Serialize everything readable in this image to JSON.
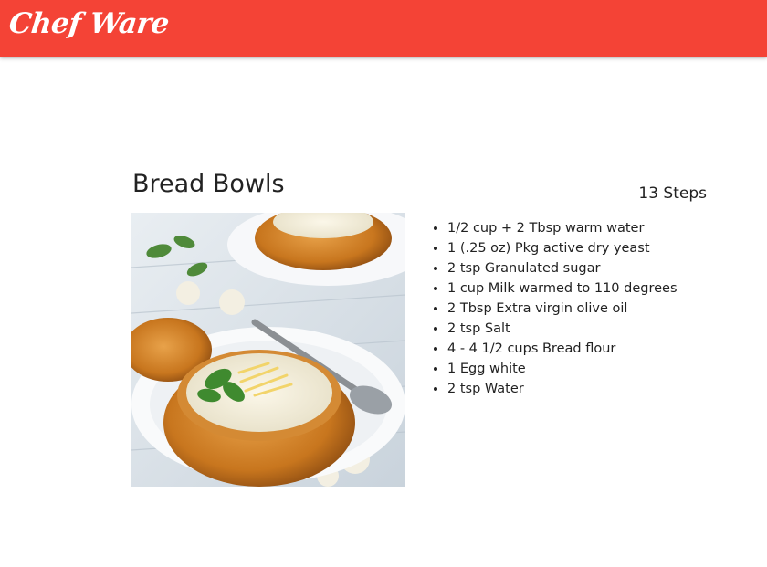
{
  "header": {
    "brand": "Chef Ware",
    "background": "#f44336"
  },
  "recipe": {
    "title": "Bread Bowls",
    "steps_label": "13 Steps",
    "image_icon": "bread-bowl-soup-photo",
    "ingredients": [
      "1/2 cup + 2 Tbsp warm water",
      "1 (.25 oz) Pkg active dry yeast",
      "2 tsp Granulated sugar",
      "1 cup Milk warmed to 110 degrees",
      "2 Tbsp Extra virgin olive oil",
      "2 tsp Salt",
      "4 - 4 1/2 cups Bread flour",
      "1 Egg white",
      "2 tsp Water"
    ]
  }
}
